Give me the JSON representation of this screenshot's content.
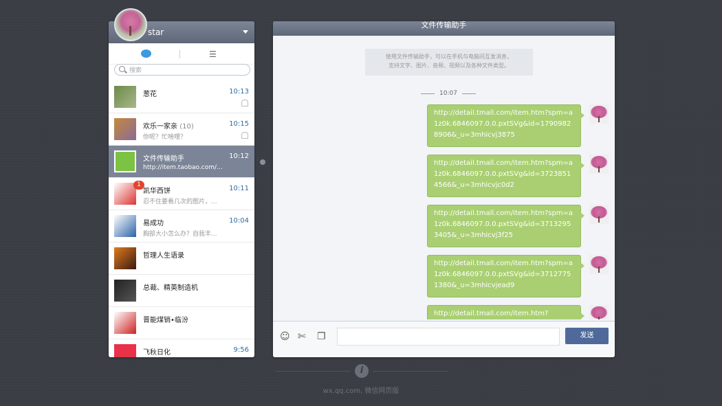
{
  "user": {
    "name": "star"
  },
  "tabs": {
    "chat_icon": "chat-bubble-icon",
    "contacts_icon": "contacts-icon"
  },
  "search": {
    "placeholder": "搜索"
  },
  "contacts": [
    {
      "name": "葱花",
      "count": "",
      "preview": "",
      "time": "10:13",
      "muted": true,
      "active": false,
      "badge": ""
    },
    {
      "name": "欢乐一家亲",
      "count": "(10)",
      "preview": "你呢？忙啥哩？",
      "time": "10:15",
      "muted": true,
      "active": false,
      "badge": ""
    },
    {
      "name": "文件传输助手",
      "count": "",
      "preview": "http://item.taobao.com/ite...",
      "time": "10:12",
      "muted": false,
      "active": true,
      "badge": ""
    },
    {
      "name": "凯华西饼",
      "count": "",
      "preview": "忍不住要看几次的图片，...",
      "time": "10:11",
      "muted": false,
      "active": false,
      "badge": "1"
    },
    {
      "name": "易成功",
      "count": "",
      "preview": "胸部大小怎么办？自我丰...",
      "time": "10:04",
      "muted": false,
      "active": false,
      "badge": ""
    },
    {
      "name": "哲理人生语录",
      "count": "",
      "preview": "",
      "time": "",
      "muted": false,
      "active": false,
      "badge": ""
    },
    {
      "name": "总裁、精英制造机",
      "count": "",
      "preview": "",
      "time": "",
      "muted": false,
      "active": false,
      "badge": ""
    },
    {
      "name": "晋能煤销•临汾",
      "count": "",
      "preview": "",
      "time": "",
      "muted": false,
      "active": false,
      "badge": ""
    },
    {
      "name": "飞秋日化",
      "count": "",
      "preview": "",
      "time": "9:56",
      "muted": false,
      "active": false,
      "badge": ""
    }
  ],
  "chat": {
    "title": "文件传输助手",
    "system_line1": "使用文件传输助手，可以在手机与电脑间互发消息，",
    "system_line2": "支持文字、图片、音频、视频以及各种文件类型。",
    "time": "10:07",
    "messages": [
      "http://detail.tmall.com/item.htm?spm=a1z0k.6846097.0.0.pxtSVg&id=17909828906&_u=3mhicvj3875",
      "http://detail.tmall.com/item.htm?spm=a1z0k.6846097.0.0.pxtSVg&id=37238514566&_u=3mhicvjc0d2",
      "http://detail.tmall.com/item.htm?spm=a1z0k.6846097.0.0.pxtSVg&id=37132953405&_u=3mhicvj3f25",
      "http://detail.tmall.com/item.htm?spm=a1z0k.6846097.0.0.pxtSVg&id=37127751380&_u=3mhicvjead9",
      "http://detail.tmall.com/item.htm?"
    ],
    "send_label": "发送"
  },
  "toolbar": {
    "emoji_icon": "emoji-icon",
    "screenshot_icon": "screenshot-icon",
    "file_icon": "file-icon"
  },
  "footer": {
    "text": "wx.qq.com, 微信网页版"
  }
}
